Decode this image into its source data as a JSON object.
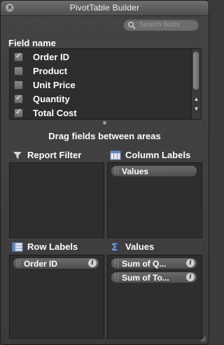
{
  "window": {
    "title": "PivotTable Builder"
  },
  "search": {
    "placeholder": "Search fields"
  },
  "fields": {
    "label": "Field name",
    "items": [
      {
        "label": "Order ID",
        "checked": true
      },
      {
        "label": "Product",
        "checked": false
      },
      {
        "label": "Unit Price",
        "checked": false
      },
      {
        "label": "Quantity",
        "checked": true
      },
      {
        "label": "Total Cost",
        "checked": true
      }
    ]
  },
  "hint": "Drag fields between areas",
  "areas": {
    "report_filter": {
      "label": "Report Filter",
      "items": []
    },
    "column_labels": {
      "label": "Column Labels",
      "items": [
        "Values"
      ]
    },
    "row_labels": {
      "label": "Row Labels",
      "items": [
        "Order ID"
      ]
    },
    "values": {
      "label": "Values",
      "items": [
        "Sum of Q...",
        "Sum of To..."
      ]
    }
  }
}
